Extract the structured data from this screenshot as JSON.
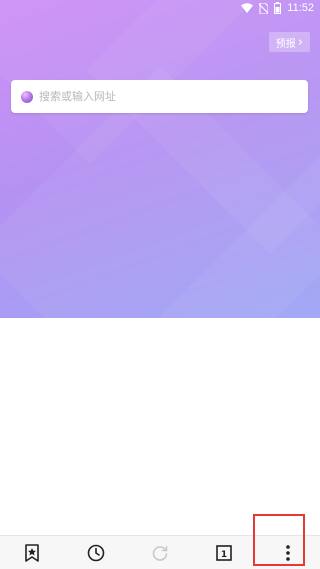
{
  "status_bar": {
    "time": "11:52",
    "icons": [
      "wifi-icon",
      "no-sim-icon",
      "battery-icon"
    ]
  },
  "header": {
    "forecast_label": "预报",
    "forecast_chevron": "›"
  },
  "search": {
    "placeholder": "搜索或输入网址",
    "icon": "browser-logo-icon"
  },
  "bottom_nav": {
    "items": [
      {
        "icon": "bookmark-star-icon"
      },
      {
        "icon": "history-clock-icon"
      },
      {
        "icon": "refresh-icon",
        "disabled": true
      },
      {
        "icon": "tabs-icon",
        "count": "1"
      },
      {
        "icon": "more-vertical-icon"
      }
    ]
  },
  "colors": {
    "gradient_start": "#cf8ff7",
    "gradient_end": "#9da5f5",
    "highlight": "#e53935"
  }
}
